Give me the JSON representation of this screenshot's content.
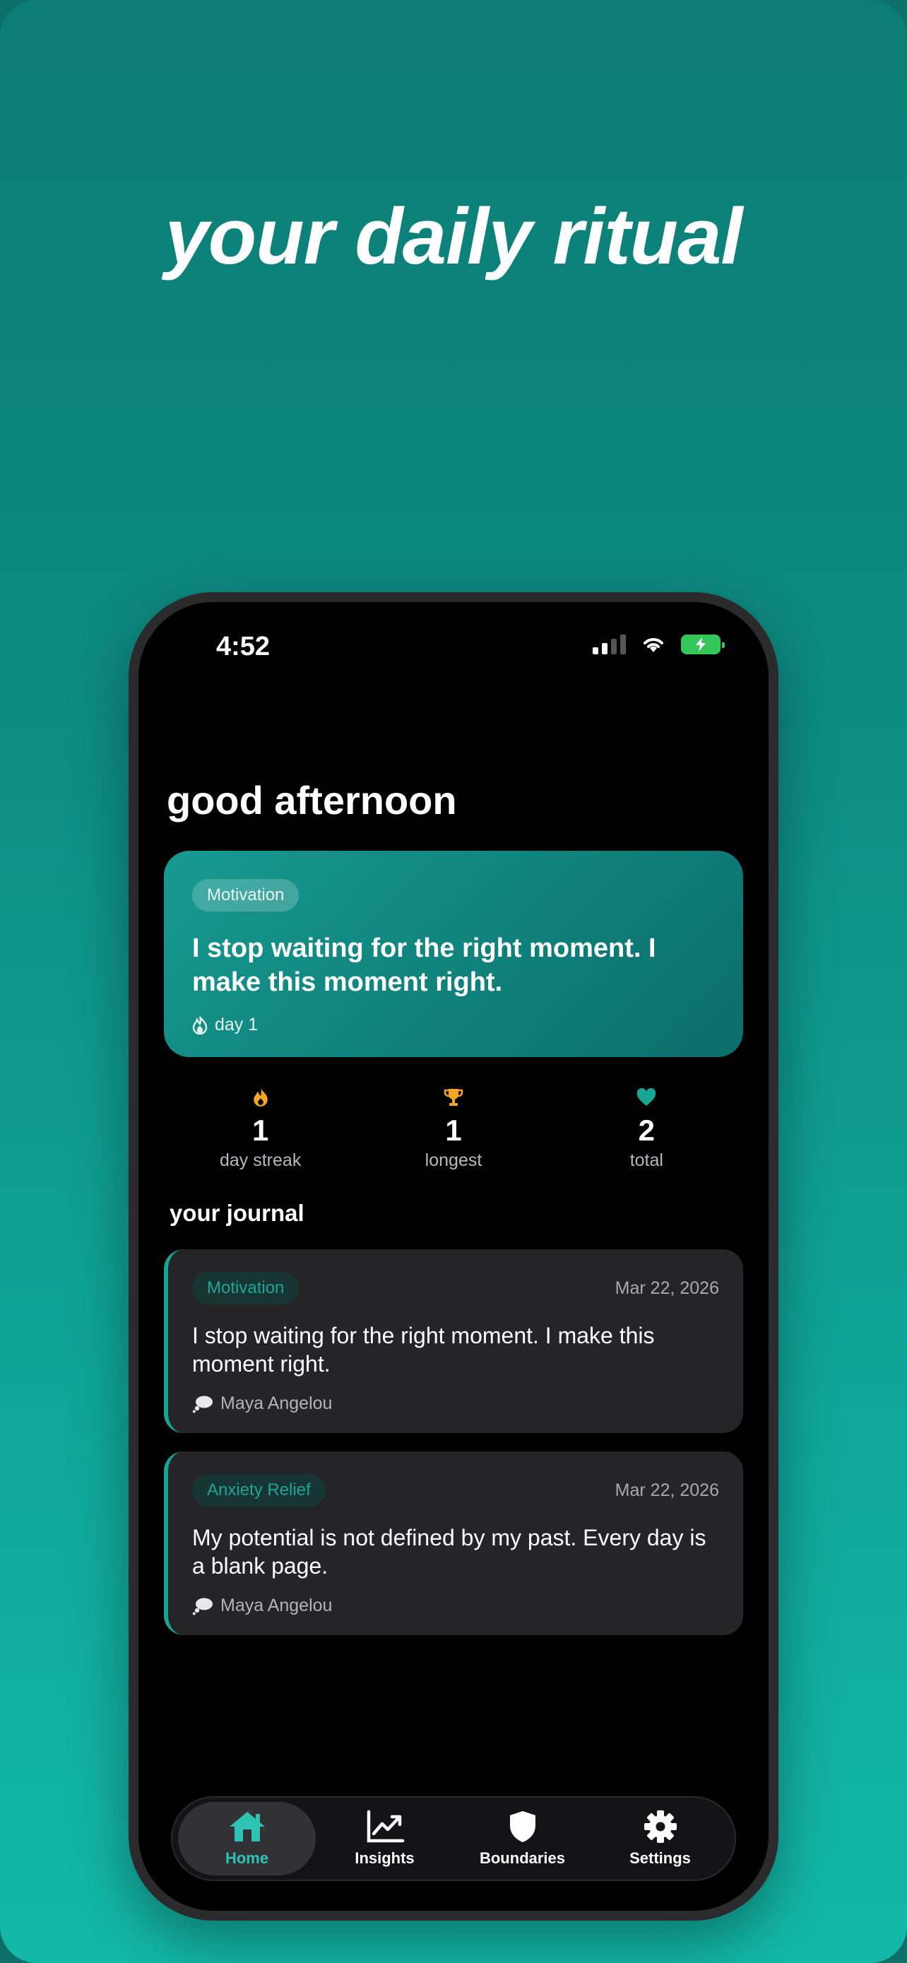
{
  "headline": "your daily ritual",
  "status_bar": {
    "time": "4:52"
  },
  "greeting": "good afternoon",
  "featured_quote": {
    "category": "Motivation",
    "text": "I stop waiting for the right moment. I make this moment right.",
    "day": "day 1"
  },
  "stats": [
    {
      "icon": "flame-icon",
      "value": "1",
      "label": "day streak"
    },
    {
      "icon": "trophy-icon",
      "value": "1",
      "label": "longest"
    },
    {
      "icon": "heart-icon",
      "value": "2",
      "label": "total"
    }
  ],
  "journal": {
    "title": "your journal",
    "entries": [
      {
        "category": "Motivation",
        "date": "Mar 22, 2026",
        "text": "I stop waiting for the right moment. I make this moment right.",
        "author": "Maya Angelou"
      },
      {
        "category": "Anxiety Relief",
        "date": "Mar 22, 2026",
        "text": "My potential is not defined by my past. Every day is a blank page.",
        "author": "Maya Angelou"
      }
    ]
  },
  "tabs": [
    {
      "icon": "home-icon",
      "label": "Home",
      "active": true
    },
    {
      "icon": "chart-icon",
      "label": "Insights",
      "active": false
    },
    {
      "icon": "shield-icon",
      "label": "Boundaries",
      "active": false
    },
    {
      "icon": "gear-icon",
      "label": "Settings",
      "active": false
    }
  ],
  "colors": {
    "accent": "#2ec4b3",
    "card_teal": "#169a91",
    "streak_orange": "#f5a623",
    "heart_teal": "#17a596"
  }
}
